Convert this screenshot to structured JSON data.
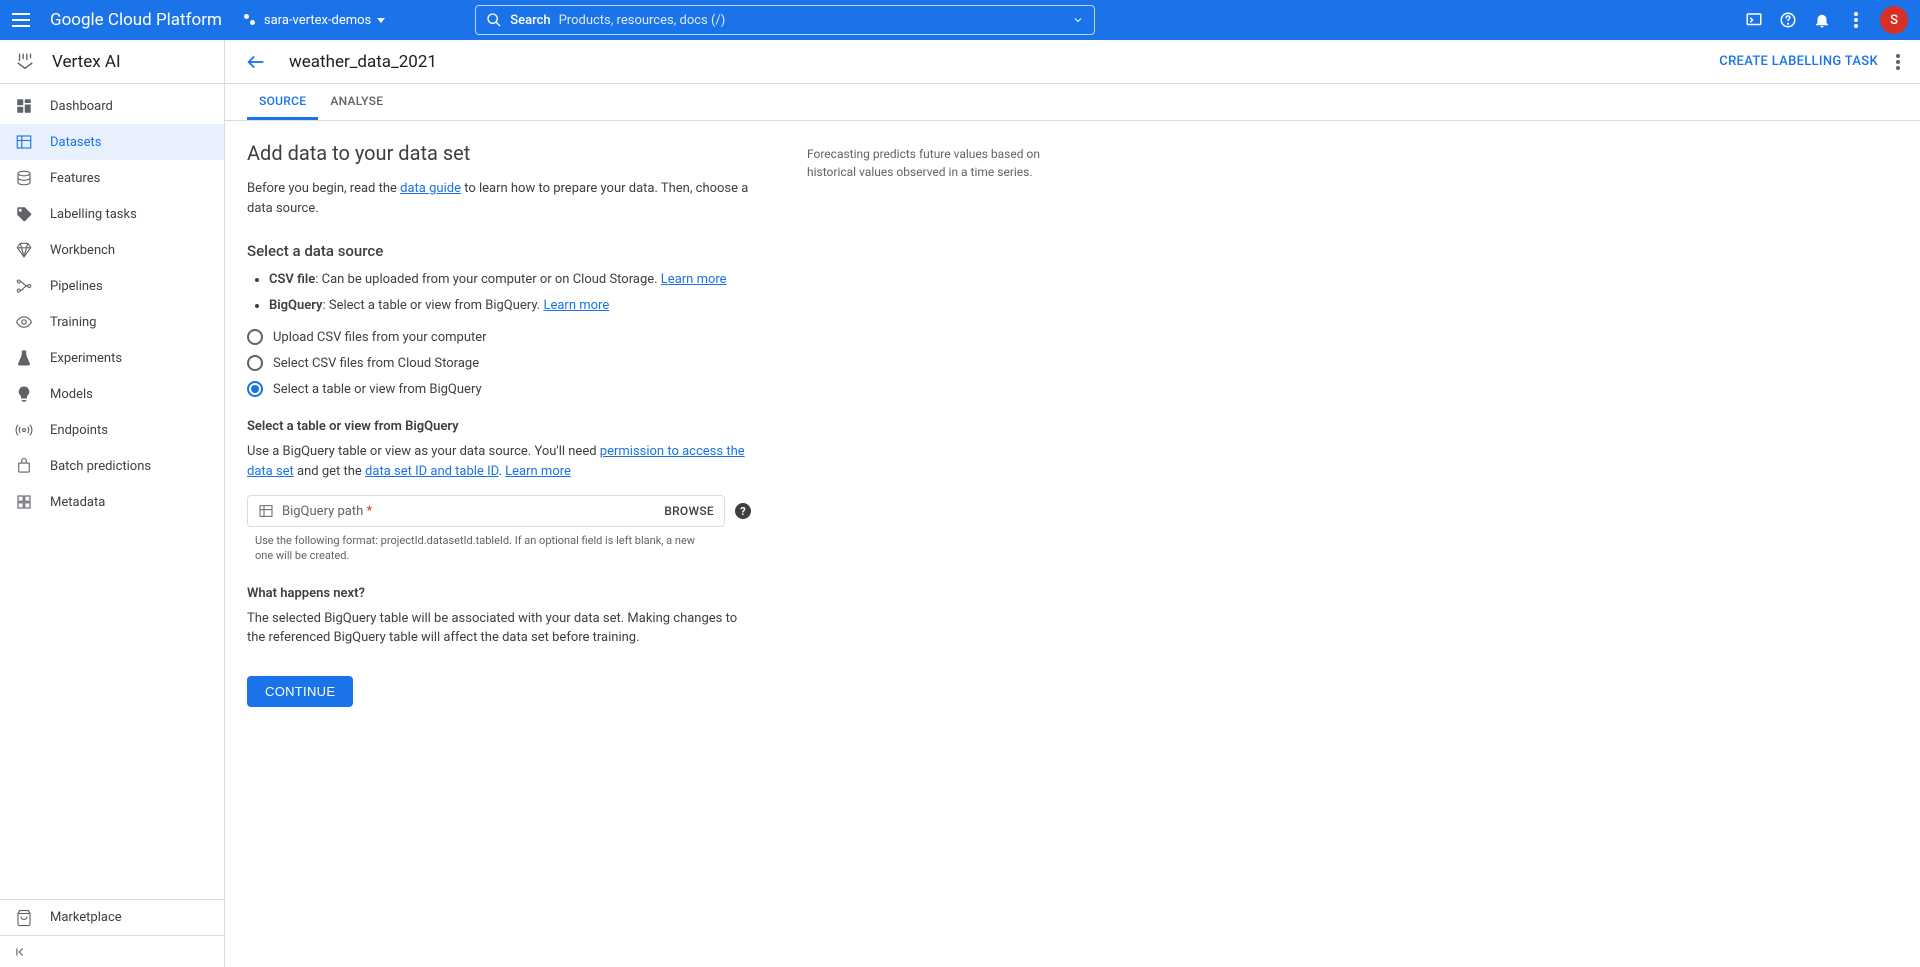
{
  "header": {
    "platform": "Google Cloud Platform",
    "project": "sara-vertex-demos",
    "search_label": "Search",
    "search_placeholder": "Products, resources, docs (/)",
    "avatar_initial": "S"
  },
  "product": "Vertex AI",
  "nav": [
    {
      "label": "Dashboard"
    },
    {
      "label": "Datasets"
    },
    {
      "label": "Features"
    },
    {
      "label": "Labelling tasks"
    },
    {
      "label": "Workbench"
    },
    {
      "label": "Pipelines"
    },
    {
      "label": "Training"
    },
    {
      "label": "Experiments"
    },
    {
      "label": "Models"
    },
    {
      "label": "Endpoints"
    },
    {
      "label": "Batch predictions"
    },
    {
      "label": "Metadata"
    }
  ],
  "nav_active": "Datasets",
  "footer_nav": "Marketplace",
  "page": {
    "title": "weather_data_2021",
    "action_link": "CREATE LABELLING TASK",
    "tabs": [
      "SOURCE",
      "ANALYSE"
    ],
    "active_tab": "SOURCE"
  },
  "content": {
    "heading": "Add data to your data set",
    "intro_before": "Before you begin, read the ",
    "intro_link": "data guide",
    "intro_after": " to learn how to prepare your data. Then, choose a data source.",
    "side_note": "Forecasting predicts future values based on historical values observed in a time series.",
    "select_source_h": "Select a data source",
    "bullets": [
      {
        "bold": "CSV file",
        "text": ": Can be uploaded from your computer or on Cloud Storage. ",
        "link": "Learn more"
      },
      {
        "bold": "BigQuery",
        "text": ": Select a table or view from BigQuery. ",
        "link": "Learn more"
      }
    ],
    "radios": [
      {
        "label": "Upload CSV files from your computer",
        "checked": false
      },
      {
        "label": "Select CSV files from Cloud Storage",
        "checked": false
      },
      {
        "label": "Select a table or view from BigQuery",
        "checked": true
      }
    ],
    "bq_h": "Select a table or view from BigQuery",
    "bq_p_before": "Use a BigQuery table or view as your data source. You'll need ",
    "bq_link1": "permission to access the data set",
    "bq_mid": " and get the ",
    "bq_link2": "data set ID and table ID",
    "bq_after2": ". ",
    "bq_link3": "Learn more",
    "field_label": "BigQuery path",
    "field_value": "",
    "browse": "BROWSE",
    "field_hint": "Use the following format: projectId.datasetId.tableId. If an optional field is left blank, a new one will be created.",
    "next_h": "What happens next?",
    "next_p": "The selected BigQuery table will be associated with your data set. Making changes to the referenced BigQuery table will affect the data set before training.",
    "continue": "CONTINUE"
  }
}
